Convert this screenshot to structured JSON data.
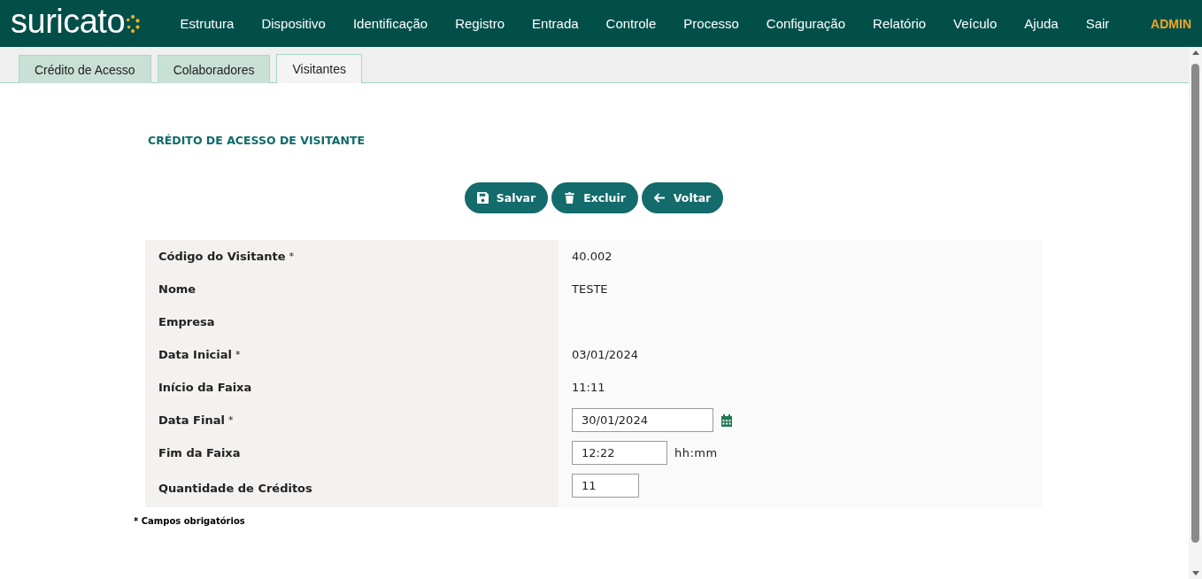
{
  "header": {
    "logo": "suricato",
    "menu": [
      "Estrutura",
      "Dispositivo",
      "Identificação",
      "Registro",
      "Entrada",
      "Controle",
      "Processo",
      "Configuração",
      "Relatório",
      "Veículo",
      "Ajuda",
      "Sair"
    ],
    "user": "ADMIN"
  },
  "tabs": [
    {
      "label": "Crédito de Acesso",
      "selected": false
    },
    {
      "label": "Colaboradores",
      "selected": false
    },
    {
      "label": "Visitantes",
      "selected": true
    }
  ],
  "form": {
    "title": "CRÉDITO DE ACESSO DE VISITANTE",
    "buttons": [
      {
        "kind": "save",
        "label": "Salvar"
      },
      {
        "kind": "delete",
        "label": "Excluir"
      },
      {
        "kind": "back",
        "label": "Voltar"
      }
    ],
    "fields": [
      {
        "label": "Código do Visitante",
        "required_mark": "*",
        "kind": "text",
        "value": "40.002"
      },
      {
        "label": "Nome",
        "kind": "text",
        "value": "TESTE"
      },
      {
        "label": "Empresa",
        "kind": "text"
      },
      {
        "label": "Data Inicial",
        "required_mark": "*",
        "kind": "text",
        "value": "03/01/2024"
      },
      {
        "label": "Início da Faixa",
        "kind": "text",
        "value": "11:11"
      },
      {
        "label": "Data Final",
        "required_mark": "*",
        "kind": "date",
        "value": "30/01/2024"
      },
      {
        "label": "Fim da Faixa",
        "kind": "time",
        "value": "12:22",
        "hint": "hh:mm"
      },
      {
        "label": "Quantidade de Créditos",
        "kind": "number",
        "value": "11"
      }
    ],
    "footnote": "* Campos obrigatórios"
  }
}
